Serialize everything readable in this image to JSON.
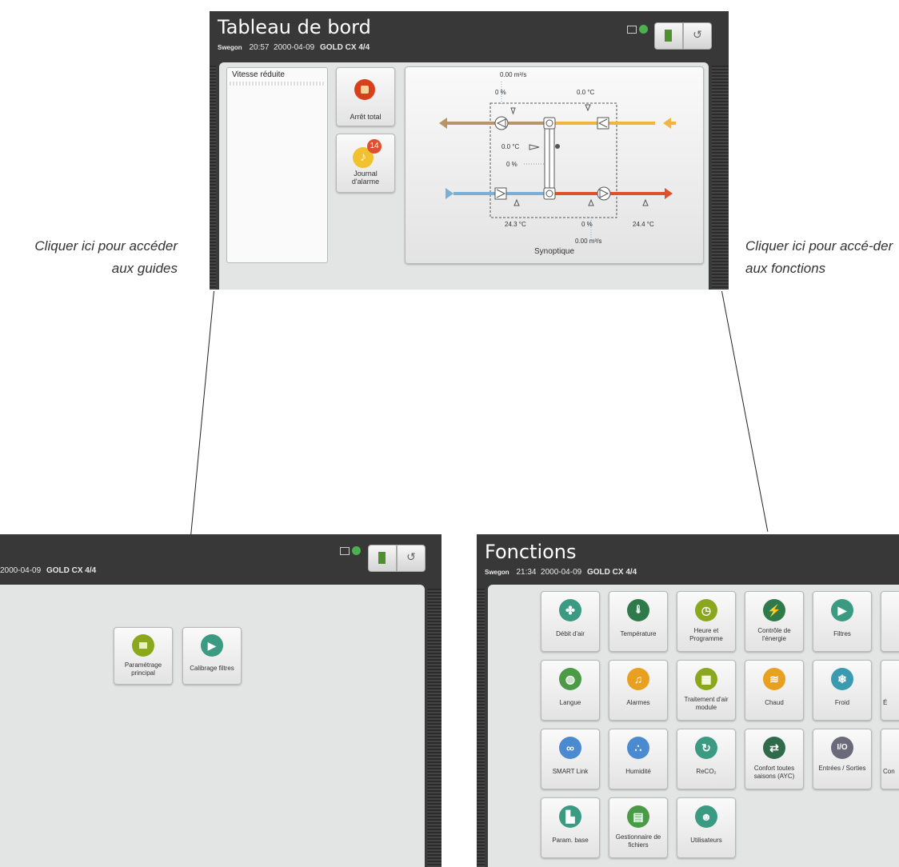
{
  "dashboard": {
    "title": "Tableau de bord",
    "brand": "Swegon",
    "time": "20:57",
    "date": "2000-04-09",
    "unit": "GOLD CX 4/4",
    "status_panel_label": "Vitesse réduite",
    "stop_button_label": "Arrêt total",
    "alarm_log_label": "Journal d'alarme",
    "alarm_count": "14",
    "synoptic": {
      "label": "Synoptique",
      "flow_top": "0.00 m³/s",
      "percent_top": "0 %",
      "temp_top_right": "0.0 °C",
      "temp_middle": "0.0 °C",
      "percent_middle": "0 %",
      "temp_bottom_left": "24.3 °C",
      "percent_bottom": "0 %",
      "temp_bottom_right": "24.4 °C",
      "flow_bottom": "0.00 m³/s"
    }
  },
  "callouts": {
    "guides": "Cliquer ici pour accéder aux guides",
    "functions": "Cliquer ici pour accé-der aux fonctions"
  },
  "guides_screen": {
    "subtitle_fragment": "2000-04-09",
    "unit": "GOLD CX 4/4",
    "tiles": [
      {
        "label": "Paramétrage principal",
        "color": "#8ba81c",
        "icon": "settings-icon"
      },
      {
        "label": "Calibrage filtres",
        "color": "#3a9a82",
        "icon": "filter-icon"
      }
    ]
  },
  "functions_screen": {
    "title": "Fonctions",
    "brand": "Swegon",
    "time": "21:34",
    "date": "2000-04-09",
    "unit": "GOLD CX 4/4",
    "tiles": [
      {
        "label": "Débit d'air",
        "color": "#3a9a82",
        "icon": "fan-icon",
        "glyph": "✤"
      },
      {
        "label": "Température",
        "color": "#2f7a4a",
        "icon": "thermometer-icon",
        "glyph": "🌡"
      },
      {
        "label": "Heure et Programme",
        "color": "#8ba81c",
        "icon": "clock-icon",
        "glyph": "◷"
      },
      {
        "label": "Contrôle de l'énergie",
        "color": "#2f7a4a",
        "icon": "energy-icon",
        "glyph": "⚡"
      },
      {
        "label": "Filtres",
        "color": "#3a9a82",
        "icon": "filter-icon",
        "glyph": "▶"
      },
      {
        "label": "Langue",
        "color": "#4a9a48",
        "icon": "globe-icon",
        "glyph": "◍"
      },
      {
        "label": "Alarmes",
        "color": "#e8a020",
        "icon": "bell-icon",
        "glyph": "♫"
      },
      {
        "label": "Traitement d'air module",
        "color": "#8ba81c",
        "icon": "module-icon",
        "glyph": "▦"
      },
      {
        "label": "Chaud",
        "color": "#e8a020",
        "icon": "heat-icon",
        "glyph": "≋"
      },
      {
        "label": "Froid",
        "color": "#3a9ab0",
        "icon": "snowflake-icon",
        "glyph": "❄"
      },
      {
        "label": "SMART Link",
        "color": "#4a8ad0",
        "icon": "link-icon",
        "glyph": "∞"
      },
      {
        "label": "Humidité",
        "color": "#4a8ad0",
        "icon": "humidity-icon",
        "glyph": "∴"
      },
      {
        "label": "ReCO₂",
        "color": "#3a9a82",
        "icon": "co2-icon",
        "glyph": "↻"
      },
      {
        "label": "Confort toutes saisons (AYC)",
        "color": "#2f6a4a",
        "icon": "ayc-icon",
        "glyph": "⇄"
      },
      {
        "label": "Entrées / Sorties",
        "color": "#6a6a7a",
        "icon": "io-icon",
        "glyph": "I/O"
      },
      {
        "label": "Param. base",
        "color": "#3a9a82",
        "icon": "factory-icon",
        "glyph": "▙"
      },
      {
        "label": "Gestionnaire de fichiers",
        "color": "#4a9a48",
        "icon": "file-icon",
        "glyph": "▤"
      },
      {
        "label": "Utilisateurs",
        "color": "#3a9a82",
        "icon": "user-icon",
        "glyph": "☻"
      }
    ],
    "partial_tiles": [
      {
        "label": "É",
        "color": "#8ba81c",
        "icon": "partial-icon"
      },
      {
        "label": "Con",
        "color": "#3a9a82",
        "icon": "partial-icon"
      }
    ]
  },
  "colors": {
    "stop_red": "#d8401c",
    "alarm_yellow": "#f2c12e",
    "badge_red": "#e05030",
    "extract_tan": "#b8946a",
    "exhaust_yellow": "#f0b640",
    "supply_blue": "#7ab0d8",
    "supply_red": "#e0502a"
  }
}
